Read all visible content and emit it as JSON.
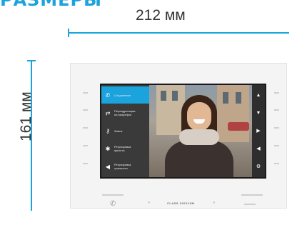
{
  "heading": "РАЗМЕРЫ",
  "dimensions": {
    "width_label": "212 мм",
    "height_label": "161 мм"
  },
  "colors": {
    "accent": "#1aa3dd",
    "device_body": "#f4f4f4",
    "screen_frame": "#1a1a1a",
    "menu_active": "#1aa3dd"
  },
  "device": {
    "brand_label": "CLASS 100X16M",
    "menu": [
      {
        "icon": "phone-icon",
        "glyph": "✆",
        "label": "Соединение",
        "active": true
      },
      {
        "icon": "transfer-icon",
        "glyph": "⇄",
        "label": "Переадресация\nна смартфон",
        "active": false
      },
      {
        "icon": "key-icon",
        "glyph": "⚷",
        "label": "Замок",
        "active": false
      },
      {
        "icon": "brightness-icon",
        "glyph": "✱",
        "label": "Регулировка\nяркости",
        "active": false
      },
      {
        "icon": "volume-icon",
        "glyph": "◀",
        "label": "Регулировка\nгромкости",
        "active": false
      }
    ],
    "controls": [
      {
        "icon": "arrow-up-icon",
        "glyph": "▲"
      },
      {
        "icon": "arrow-down-icon",
        "glyph": "▼"
      },
      {
        "icon": "arrow-right-icon",
        "glyph": "▶"
      },
      {
        "icon": "arrow-left-icon",
        "glyph": "◀"
      },
      {
        "icon": "settings-icon",
        "glyph": "⚙"
      }
    ]
  }
}
